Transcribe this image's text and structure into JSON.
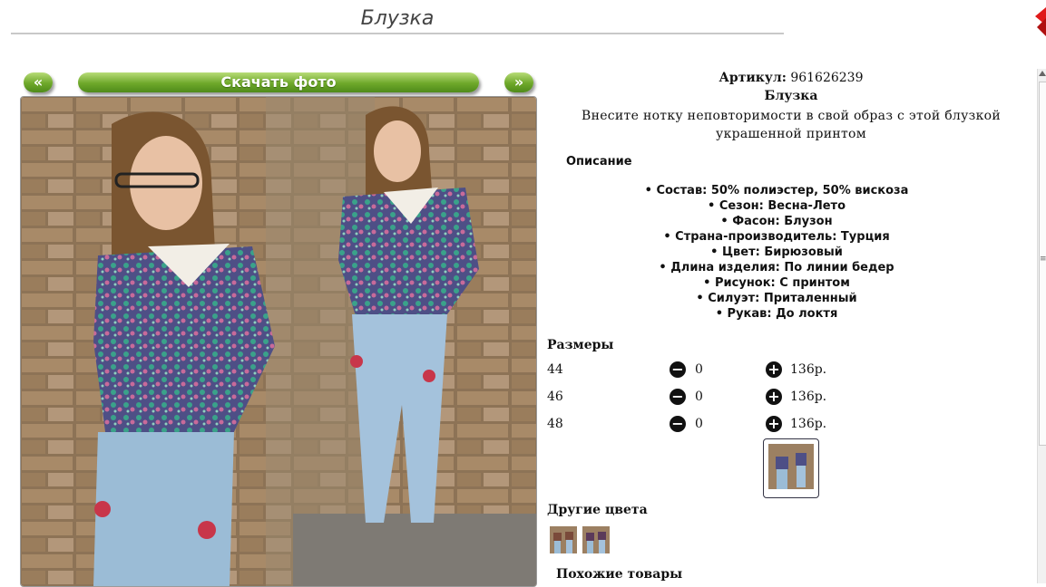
{
  "header": {
    "title": "Блузка"
  },
  "gallery": {
    "prev_label": "«",
    "next_label": "»",
    "download_label": "Скачать фото"
  },
  "product": {
    "sku_label": "Артикул:",
    "sku_value": "961626239",
    "name": "Блузка",
    "description": "Внесите нотку неповторимости в свой образ с этой блузкой украшенной принтом",
    "description_title": "Описание",
    "attributes": [
      "Состав: 50% полиэстер, 50% вискоза",
      "Сезон: Весна-Лето",
      "Фасон: Блузон",
      "Страна-производитель: Турция",
      "Цвет: Бирюзовый",
      "Длина изделия: По линии бедер",
      "Рисунок: С принтом",
      "Силуэт: Приталенный",
      "Рукав: До локтя"
    ]
  },
  "sizes": {
    "title": "Размеры",
    "rows": [
      {
        "size": "44",
        "qty": "0",
        "price": "136р."
      },
      {
        "size": "46",
        "qty": "0",
        "price": "136р."
      },
      {
        "size": "48",
        "qty": "0",
        "price": "136р."
      }
    ]
  },
  "colors": {
    "title": "Другие цвета"
  },
  "similar": {
    "title": "Похожие товары"
  },
  "theme": {
    "button_green": "#6ea82a",
    "logo_red": "#d81818"
  }
}
